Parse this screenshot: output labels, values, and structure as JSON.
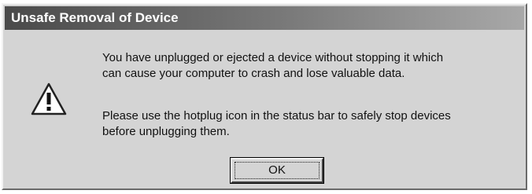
{
  "dialog": {
    "title": "Unsafe Removal of Device",
    "icon": "warning-icon",
    "message_lines_1": [
      "You have unplugged or ejected a device without stopping it which",
      "can cause your computer to crash and lose valuable data."
    ],
    "message_lines_2": [
      "Please use the hotplug icon in the status bar to safely stop devices",
      "before unplugging them."
    ],
    "ok_label": "OK"
  }
}
